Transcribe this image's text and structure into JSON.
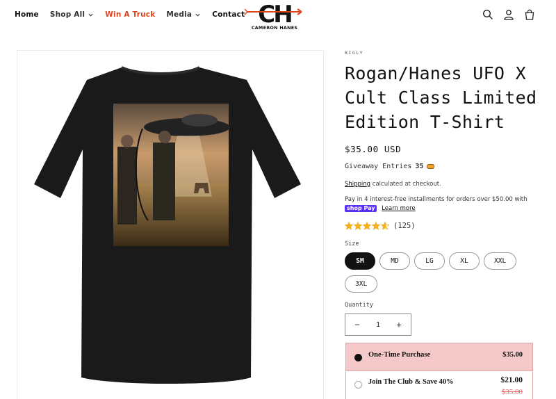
{
  "nav": {
    "items": [
      {
        "label": "Home"
      },
      {
        "label": "Shop All"
      },
      {
        "label": "Win A Truck"
      },
      {
        "label": "Media"
      },
      {
        "label": "Contact"
      }
    ]
  },
  "logo": {
    "monogram": "CH",
    "name": "CAMERON HANES"
  },
  "header_icons": [
    "search-icon",
    "account-icon",
    "cart-icon"
  ],
  "product": {
    "vendor": "BIGLY",
    "title": "Rogan/Hanes UFO X Cult Class Limited Edition T-Shirt",
    "price": "$35.00 USD",
    "giveaway_label": "Giveaway Entries",
    "giveaway_count": "35",
    "shipping_link": "Shipping",
    "shipping_text": " calculated at checkout.",
    "installments_text": "Pay in 4 interest-free installments for orders over $50.00 with",
    "shoppay_label": "shop Pay",
    "learn_more": "Learn more",
    "rating_value": 4.6,
    "rating_count": "(125)",
    "size_label": "Size",
    "sizes": [
      "SM",
      "MD",
      "LG",
      "XL",
      "XXL",
      "3XL"
    ],
    "selected_size": "SM",
    "quantity_label": "Quantity",
    "quantity": "1",
    "minus": "−",
    "plus": "+"
  },
  "plans": [
    {
      "name": "One-Time Purchase",
      "price": "$35.00"
    },
    {
      "name": "Join The Club & Save 40%",
      "price": "$21.00",
      "old_price": "$35.00"
    }
  ],
  "colors": {
    "accent": "#e0431e",
    "selected_plan": "#f5c9c9",
    "star": "#f2b01e",
    "shoppay": "#5a31f4"
  }
}
